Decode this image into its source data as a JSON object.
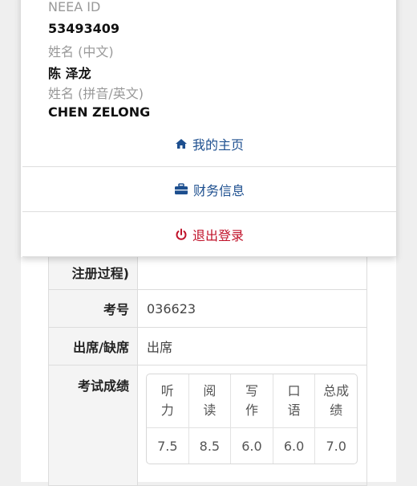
{
  "profile": {
    "neea_id_label": "NEEA ID",
    "neea_id_value": "53493409",
    "name_cn_label": "姓名 (中文)",
    "name_cn_value": "陈 泽龙",
    "name_en_label": "姓名 (拼音/英文)",
    "name_en_value": "CHEN ZELONG"
  },
  "menu": {
    "home": "我的主页",
    "finance": "财务信息",
    "logout": "退出登录"
  },
  "colors": {
    "accent_blue": "#1d4f8f",
    "logout_red": "#c0132a"
  },
  "details": {
    "registration_label": "注册过程)",
    "registration_value": "",
    "exam_number_label": "考号",
    "exam_number_value": "036623",
    "attendance_label": "出席/缺席",
    "attendance_value": "出席",
    "score_label": "考试成绩",
    "score_headers": [
      "听\n力",
      "阅\n读",
      "写\n作",
      "口\n语",
      "总成\n绩"
    ],
    "score_values": [
      "7.5",
      "8.5",
      "6.0",
      "6.0",
      "7.0"
    ]
  }
}
